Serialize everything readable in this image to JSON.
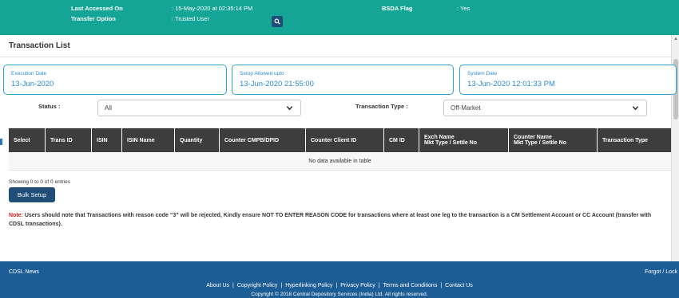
{
  "header": {
    "last_accessed_label": "Last Accessed On",
    "last_accessed_value": ": 15-May-2020 at 02:35:14 PM",
    "bsda_label": "BSDA Flag",
    "bsda_value": ": Yes",
    "transfer_label": "Transfer Option",
    "transfer_value": ": Trusted User",
    "search_icon": "search-icon"
  },
  "section": {
    "title": "Transaction List"
  },
  "dates": [
    {
      "label": "Execution Date",
      "value": "13-Jun-2020"
    },
    {
      "label": "Setup Allowed upto",
      "value": "13-Jun-2020 21:55:00"
    },
    {
      "label": "System Date",
      "value": "13-Jun-2020 12:01:33 PM"
    }
  ],
  "filters": {
    "status_label": "Status :",
    "status_value": "All",
    "type_label": "Transaction Type :",
    "type_value": "Off-Market"
  },
  "table": {
    "columns": [
      {
        "line1": "Select",
        "line2": ""
      },
      {
        "line1": "Trans ID",
        "line2": ""
      },
      {
        "line1": "ISIN",
        "line2": ""
      },
      {
        "line1": "ISIN Name",
        "line2": ""
      },
      {
        "line1": "Quantity",
        "line2": ""
      },
      {
        "line1": "Counter CMPB/DPID",
        "line2": ""
      },
      {
        "line1": "Counter Client ID",
        "line2": ""
      },
      {
        "line1": "CM ID",
        "line2": ""
      },
      {
        "line1": "Exch Name",
        "line2": "Mkt Type / Settle No"
      },
      {
        "line1": "Counter Name",
        "line2": "Mkt Type / Settle No"
      },
      {
        "line1": "Transaction Type",
        "line2": ""
      }
    ],
    "empty_message": "No data available in table",
    "showing": "Showing 0 to 0 of 0 entries"
  },
  "actions": {
    "bulk_setup": "Bulk Setup"
  },
  "note": {
    "label": "Note:",
    "text": " Users should note that Transactions with reason code “3” will be rejected, Kindly ensure NOT TO ENTER REASON CODE for transactions where at least one leg to the transaction is a CM Settlement Account or CC Account (transfer with CDSL transactions)."
  },
  "footer": {
    "news": "CDSL News",
    "forgot": "Forgot / Lock",
    "links": [
      "About Us",
      "Copyright Policy",
      "Hyperlinking Policy",
      "Privacy Policy",
      "Terms and Conditions",
      "Contact Us"
    ],
    "copyright": "Copyright © 2018 Central Depository Services (India) Ltd. All rights reserved."
  },
  "colors": {
    "teal": "#15a596",
    "navy": "#1f4e79",
    "footer": "#1d5d95",
    "table_header": "#3d3d3d",
    "date_border": "#2aa6d6",
    "note_red": "#d01e1e"
  }
}
